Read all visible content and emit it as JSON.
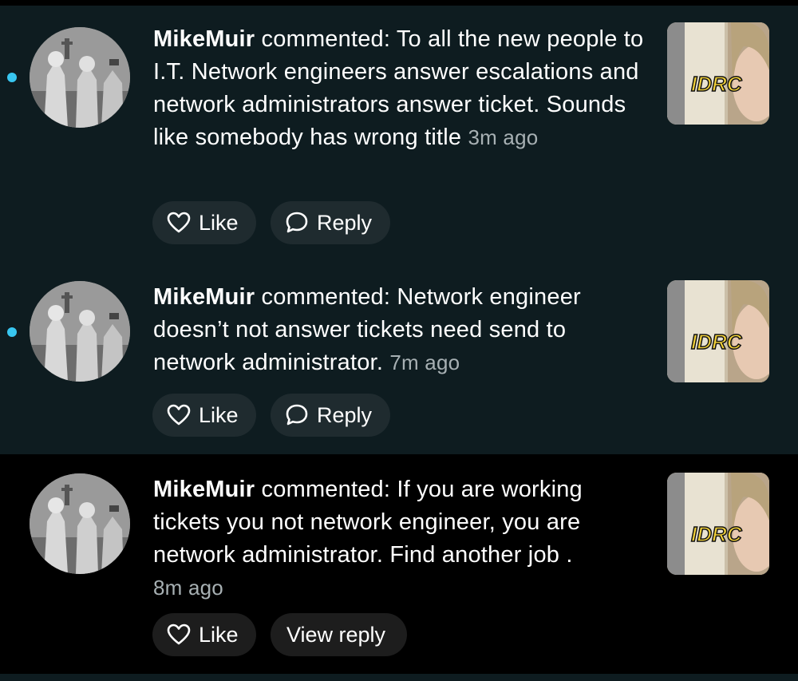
{
  "notifications": [
    {
      "unread": true,
      "username": "MikeMuir",
      "action": " commented: ",
      "comment": "To all the new people to I.T. Network engineers answer escalations and network administrators answer ticket. Sounds like somebody has wrong title",
      "time": "3m ago",
      "like_label": "Like",
      "reply_label": "Reply",
      "thumb_caption": "IDRC"
    },
    {
      "unread": true,
      "username": "MikeMuir",
      "action": " commented: ",
      "comment": "Network engineer doesn’t not answer tickets need send to network administrator.",
      "time": "7m ago",
      "like_label": "Like",
      "reply_label": "Reply",
      "thumb_caption": "IDRC"
    },
    {
      "unread": false,
      "username": "MikeMuir",
      "action": " commented: ",
      "comment": "If you are working tickets you not network engineer, you are network administrator. Find another job .",
      "time": "8m ago",
      "like_label": "Like",
      "reply_label": "View reply",
      "thumb_caption": "IDRC"
    }
  ],
  "colors": {
    "unread_bg": "#0e1c20",
    "read_bg": "#000000",
    "unread_dot": "#38c6f0",
    "timestamp": "#a7b0b3"
  },
  "icons": {
    "like": "heart-icon",
    "reply": "speech-bubble-icon"
  }
}
